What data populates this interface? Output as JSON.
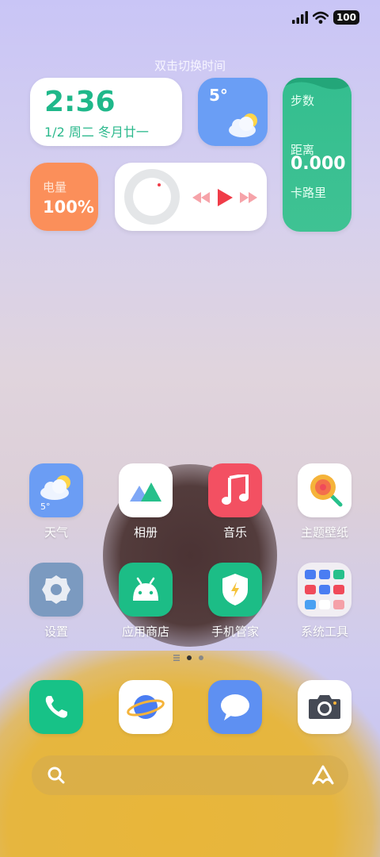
{
  "status_bar": {
    "battery": "100",
    "icons": [
      "signal-icon",
      "wifi-icon",
      "battery-icon"
    ]
  },
  "hint": "双击切换时间",
  "widgets": {
    "clock": {
      "time": "2:36",
      "date": "1/2 周二 冬月廿一"
    },
    "weather": {
      "temp": "5°",
      "icon": "partly-cloudy-icon"
    },
    "steps": {
      "steps_label": "步数",
      "distance_label": "距离",
      "value": "0.000",
      "calorie_label": "卡路里"
    },
    "battery": {
      "label": "电量",
      "value": "100%"
    },
    "music": {
      "icons": [
        "previous-icon",
        "play-icon",
        "next-icon"
      ]
    }
  },
  "apps": [
    {
      "label": "天气",
      "badge": "5°"
    },
    {
      "label": "相册"
    },
    {
      "label": "音乐"
    },
    {
      "label": "主题壁纸"
    },
    {
      "label": "设置"
    },
    {
      "label": "应用商店"
    },
    {
      "label": "手机管家"
    },
    {
      "label": "系统工具"
    }
  ],
  "dock": [
    "phone-icon",
    "browser-icon",
    "messages-icon",
    "camera-icon"
  ],
  "colors": {
    "green": "#1fb88a",
    "weather_blue": "#6a9ef5",
    "orange": "#fb8f5a",
    "red": "#f03c48"
  }
}
